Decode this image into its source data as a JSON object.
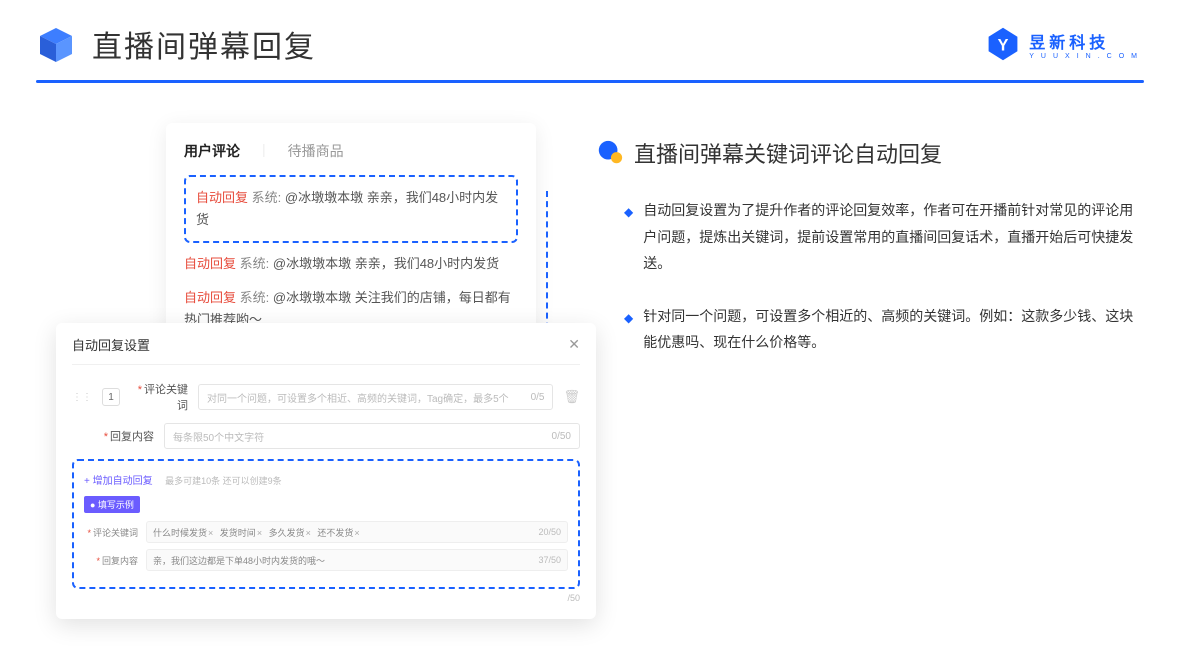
{
  "header": {
    "title": "直播间弹幕回复",
    "logo_cn": "昱新科技",
    "logo_en": "YUUXIN.COM"
  },
  "comments": {
    "tab_active": "用户评论",
    "tab_inactive": "待播商品",
    "tag": "自动回复",
    "sys": "系统:",
    "highlighted": "@冰墩墩本墩 亲亲，我们48小时内发货",
    "row2": "@冰墩墩本墩 亲亲，我们48小时内发货",
    "row3": "@冰墩墩本墩 关注我们的店铺，每日都有热门推荐哟～"
  },
  "modal": {
    "title": "自动回复设置",
    "num": "1",
    "label_keyword": "评论关键词",
    "placeholder_keyword": "对同一个问题，可设置多个相近、高频的关键词，Tag确定，最多5个",
    "count_keyword": "0/5",
    "label_reply": "回复内容",
    "placeholder_reply": "每条限50个中文字符",
    "count_reply": "0/50",
    "add_link": "+ 增加自动回复",
    "add_hint": "最多可建10条 还可以创建9条",
    "example_badge": "● 填写示例",
    "ex_kw_label": "评论关键词",
    "ex_tags": [
      "什么时候发货",
      "发货时间",
      "多久发货",
      "还不发货"
    ],
    "ex_kw_count": "20/50",
    "ex_reply_label": "回复内容",
    "ex_reply_text": "亲，我们这边都是下单48小时内发货的哦～",
    "ex_reply_count": "37/50",
    "bottom": "/50"
  },
  "right": {
    "title": "直播间弹幕关键词评论自动回复",
    "bullet1": "自动回复设置为了提升作者的评论回复效率，作者可在开播前针对常见的评论用户问题，提炼出关键词，提前设置常用的直播间回复话术，直播开始后可快捷发送。",
    "bullet2": "针对同一个问题，可设置多个相近的、高频的关键词。例如：这款多少钱、这块能优惠吗、现在什么价格等。"
  }
}
